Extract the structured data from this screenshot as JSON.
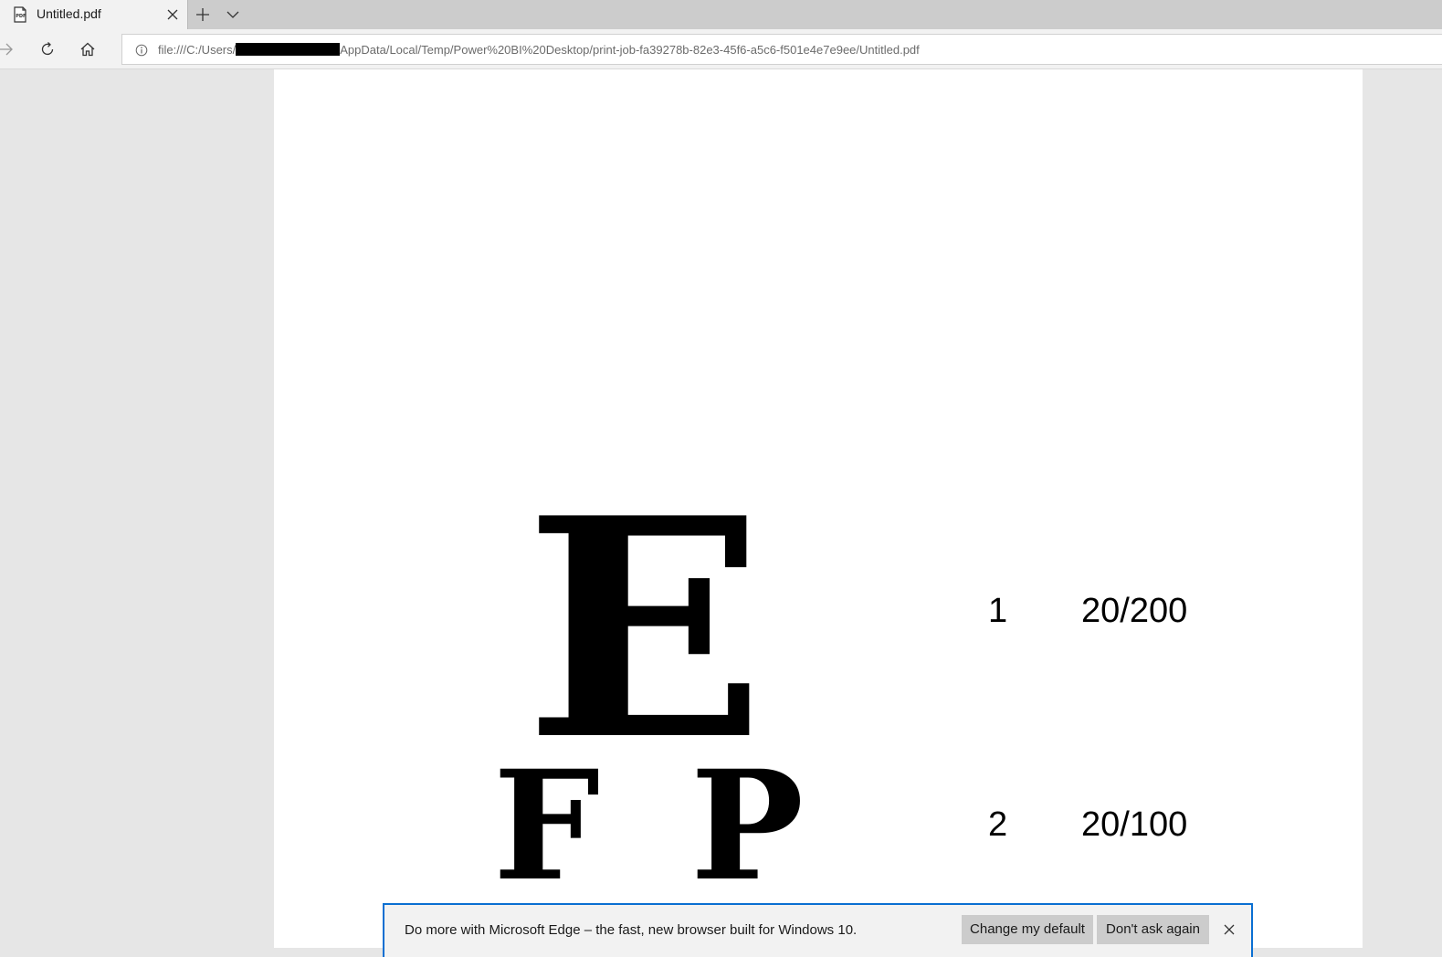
{
  "tab": {
    "title": "Untitled.pdf",
    "icon": "pdf-file-icon"
  },
  "toolbar": {
    "icons": [
      "forward-arrow-icon",
      "refresh-icon",
      "home-icon",
      "info-icon",
      "close-icon",
      "plus-icon",
      "chevron-down-icon"
    ]
  },
  "address": {
    "url_prefix": "file:///C:/Users/",
    "url_suffix": "AppData/Local/Temp/Power%20BI%20Desktop/print-job-fa39278b-82e3-45f6-a5c6-f501e4e7e9ee/Untitled.pdf"
  },
  "document": {
    "rows": [
      {
        "letters": [
          "E"
        ],
        "number": "1",
        "acuity": "20/200"
      },
      {
        "letters": [
          "F",
          "P"
        ],
        "number": "2",
        "acuity": "20/100"
      }
    ]
  },
  "notification": {
    "message": "Do more with Microsoft Edge – the fast, new browser built for Windows 10.",
    "change_default_label": "Change my default",
    "dont_ask_label": "Don't ask again"
  },
  "colors": {
    "accent": "#0a6fd2",
    "tab_strip": "#cccccc",
    "viewer_bg": "#e6e6e6"
  }
}
